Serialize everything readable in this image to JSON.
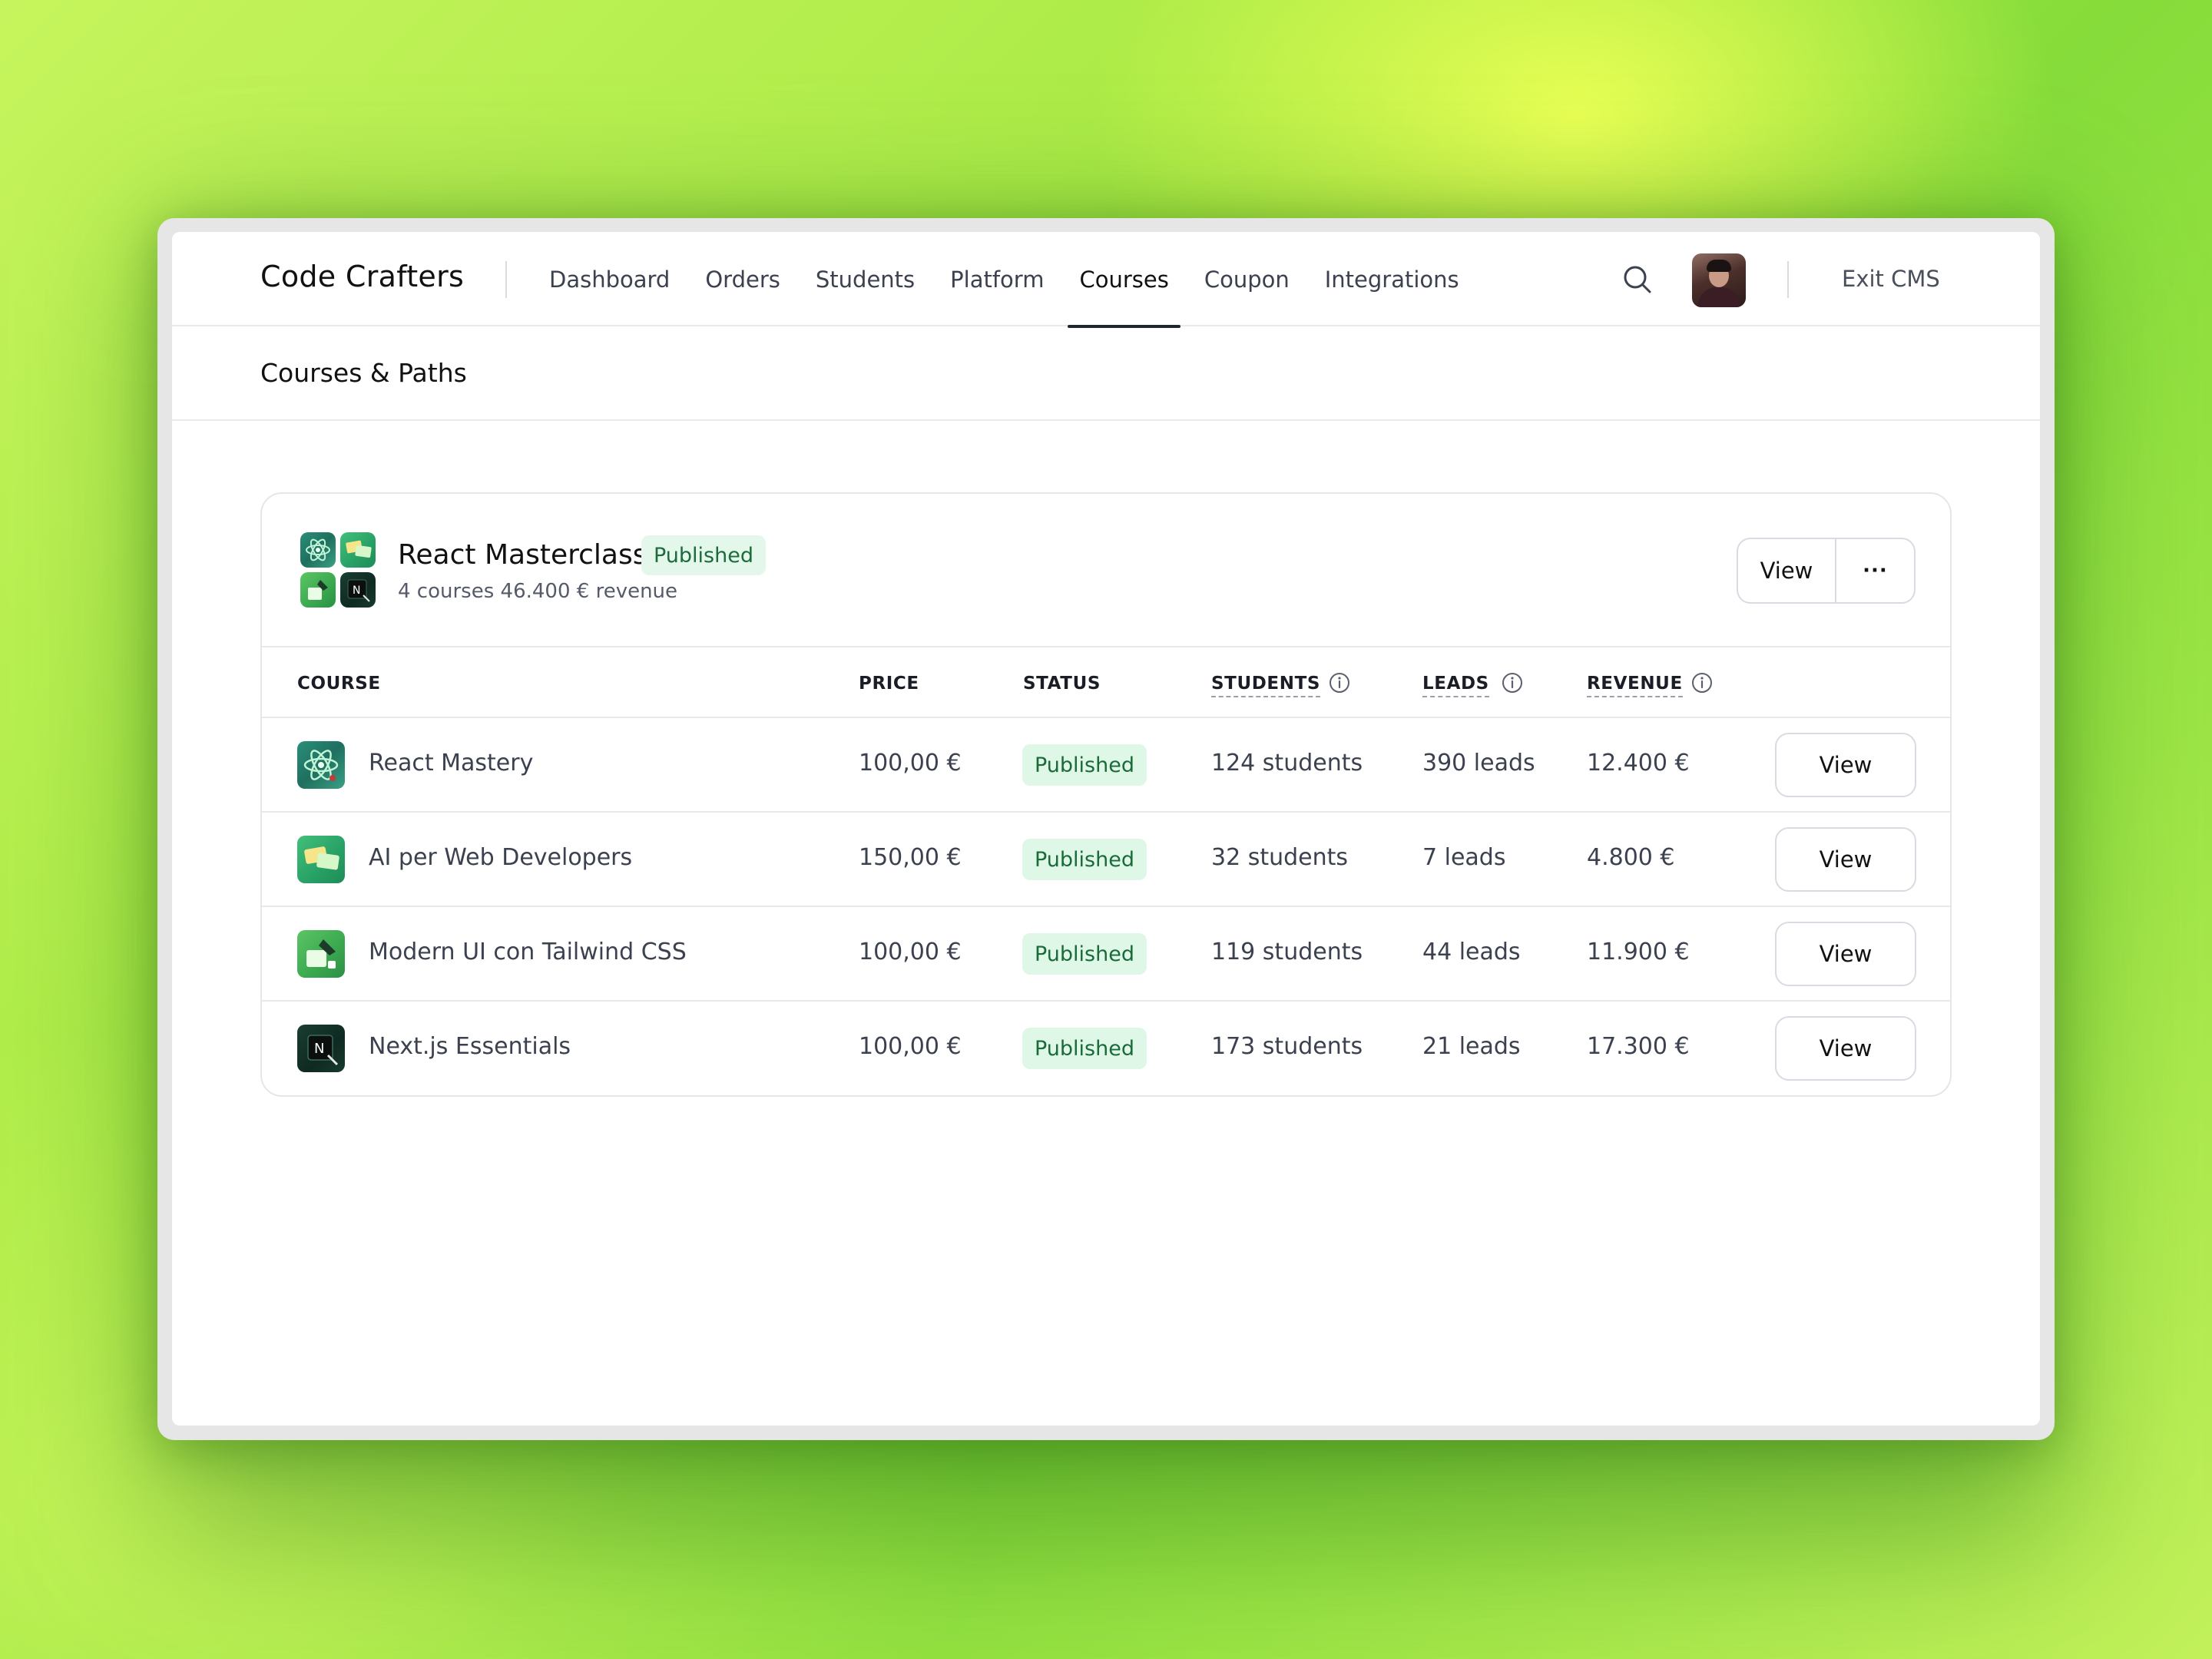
{
  "app": {
    "brand": "Code Crafters",
    "nav": [
      {
        "label": "Dashboard",
        "active": false
      },
      {
        "label": "Orders",
        "active": false
      },
      {
        "label": "Students",
        "active": false
      },
      {
        "label": "Platform",
        "active": false
      },
      {
        "label": "Courses",
        "active": true
      },
      {
        "label": "Coupon",
        "active": false
      },
      {
        "label": "Integrations",
        "active": false
      }
    ],
    "search_icon": "search-icon",
    "avatar_icon": "user-avatar",
    "exit_label": "Exit CMS"
  },
  "page": {
    "title": "Courses & Paths"
  },
  "path": {
    "title": "React Masterclass",
    "status": "Published",
    "meta": "4 courses 46.400 € revenue",
    "view_label": "View",
    "more_label": "···"
  },
  "table": {
    "columns": {
      "course": "COURSE",
      "price": "PRICE",
      "status": "STATUS",
      "students": "STUDENTS",
      "leads": "LEADS",
      "revenue": "REVENUE"
    },
    "rows": [
      {
        "name": "React Mastery",
        "price": "100,00 €",
        "status": "Published",
        "students": "124 students",
        "leads": "390 leads",
        "revenue": "12.400 €",
        "action": "View",
        "thumb": "react-atom-icon"
      },
      {
        "name": "AI per Web Developers",
        "price": "150,00 €",
        "status": "Published",
        "students": "32 students",
        "leads": "7 leads",
        "revenue": "4.800 €",
        "action": "View",
        "thumb": "ai-cards-icon"
      },
      {
        "name": "Modern UI con Tailwind CSS",
        "price": "100,00 €",
        "status": "Published",
        "students": "119 students",
        "leads": "44 leads",
        "revenue": "11.900 €",
        "action": "View",
        "thumb": "tailwind-brush-icon"
      },
      {
        "name": "Next.js Essentials",
        "price": "100,00 €",
        "status": "Published",
        "students": "173 students",
        "leads": "21 leads",
        "revenue": "17.300 €",
        "action": "View",
        "thumb": "nextjs-logo-icon"
      }
    ]
  },
  "colors": {
    "published_bg": "#dff7e7",
    "published_text": "#1a6a3a",
    "background_green": "#a9ea45"
  }
}
